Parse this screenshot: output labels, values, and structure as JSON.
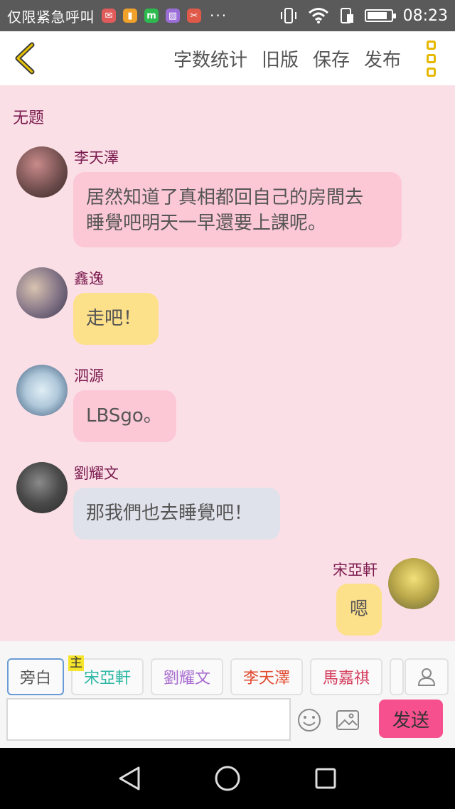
{
  "status_bar": {
    "carrier": "仅限紧急呼叫",
    "app_icons": [
      {
        "name": "mail-app-icon",
        "color": "#e15b5b",
        "glyph": "✉"
      },
      {
        "name": "wallet-app-icon",
        "color": "#f0a12a",
        "glyph": "▮"
      },
      {
        "name": "m-app-icon",
        "color": "#2dbb4f",
        "glyph": "m"
      },
      {
        "name": "gallery-app-icon",
        "color": "#9a6dd8",
        "glyph": "▧"
      },
      {
        "name": "tool-app-icon",
        "color": "#e05a4a",
        "glyph": "✂"
      }
    ],
    "more": "···",
    "time": "08:23",
    "battery_level": 0.85
  },
  "toolbar": {
    "word_count": "字数统计",
    "old_version": "旧版",
    "save": "保存",
    "publish": "发布"
  },
  "chat": {
    "title": "无题",
    "messages": [
      {
        "name": "李天澤",
        "text_line1": "居然知道了真相都回自己的房間去",
        "text_line2": "睡覺吧明天一早還要上課呢。",
        "bubble_color": "#fcc8d6",
        "avatar_colors": [
          "#6b4a4a",
          "#c98a8a"
        ]
      },
      {
        "name": "鑫逸",
        "text": "走吧！",
        "bubble_color": "#fde08a",
        "avatar_colors": [
          "#3a3550",
          "#d8c3b0"
        ]
      },
      {
        "name": "泗源",
        "text": "LBSgo。",
        "bubble_color": "#fcc8d6",
        "avatar_colors": [
          "#3a5a7a",
          "#e0eef5"
        ]
      },
      {
        "name": "劉耀文",
        "text": "那我們也去睡覺吧！",
        "bubble_color": "#dfe2ea",
        "avatar_colors": [
          "#2a2a2a",
          "#8a8a8a"
        ]
      },
      {
        "name": "宋亞軒",
        "text": "嗯",
        "bubble_color": "#fde08a",
        "avatar_colors": [
          "#8a7a3a",
          "#f2e07a"
        ]
      }
    ]
  },
  "panel": {
    "narrator": "旁白",
    "main_tag": "主",
    "chars": [
      "宋亞軒",
      "劉耀文",
      "李天澤",
      "馬嘉祺"
    ],
    "send": "发送",
    "input_placeholder": ""
  }
}
